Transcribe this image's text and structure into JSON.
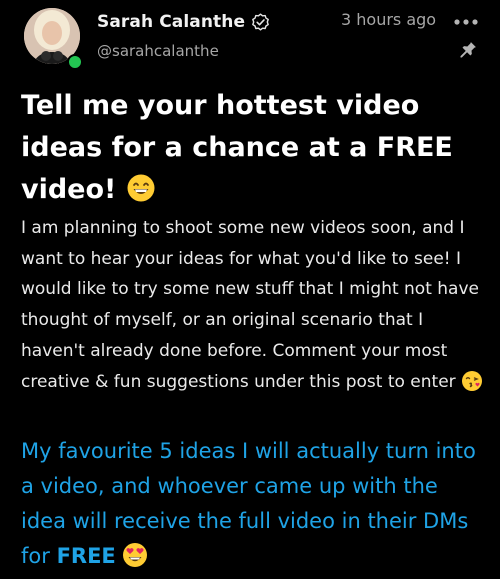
{
  "post": {
    "author_name": "Sarah Calanthe",
    "author_handle": "@sarahcalanthe",
    "timestamp": "3 hours ago",
    "title": "Tell me your hottest video ideas for a chance at a FREE video!",
    "body": "I am planning to shoot some new videos soon, and I want to hear your ideas for what you'd like to see! I would like to try some new stuff that I might not have thought of myself, or an original scenario that I haven't already done before. Comment your most creative & fun suggestions under this post to enter",
    "highlight_text": "My favourite 5 ideas I will actually turn into a video, and whoever came up with the idea will receive the full video in their DMs for",
    "highlight_bold": "FREE"
  },
  "icons": {
    "verified": "verified-badge-icon",
    "more": "more-options-icon",
    "pin": "pin-icon",
    "title_emoji": "grinning-face-emoji",
    "body_emoji": "face-blowing-kiss-emoji",
    "highlight_emoji": "heart-eyes-emoji"
  },
  "colors": {
    "background": "#000000",
    "highlight": "#1fa3e6",
    "online": "#23c552",
    "muted": "#a6a6a6"
  }
}
